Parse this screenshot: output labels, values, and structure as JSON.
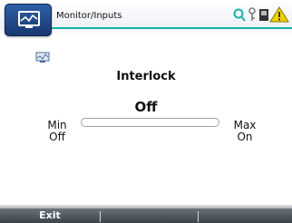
{
  "header": {
    "title": "Monitor/Inputs",
    "app_icon": "monitor-icon"
  },
  "status_icons": [
    "search-icon",
    "key-icon",
    "battery-icon",
    "warning-icon"
  ],
  "content": {
    "icon": "monitor-icon",
    "parameter_name": "Interlock",
    "current_value": "Off",
    "min_label": "Min",
    "min_value": "Off",
    "max_label": "Max",
    "max_value": "On",
    "level_fraction": 0
  },
  "softkeys": [
    "Exit",
    "",
    ""
  ],
  "colors": {
    "accent": "#18b3aa",
    "app_icon_bg": "#234c8f",
    "warning": "#f0d000"
  }
}
